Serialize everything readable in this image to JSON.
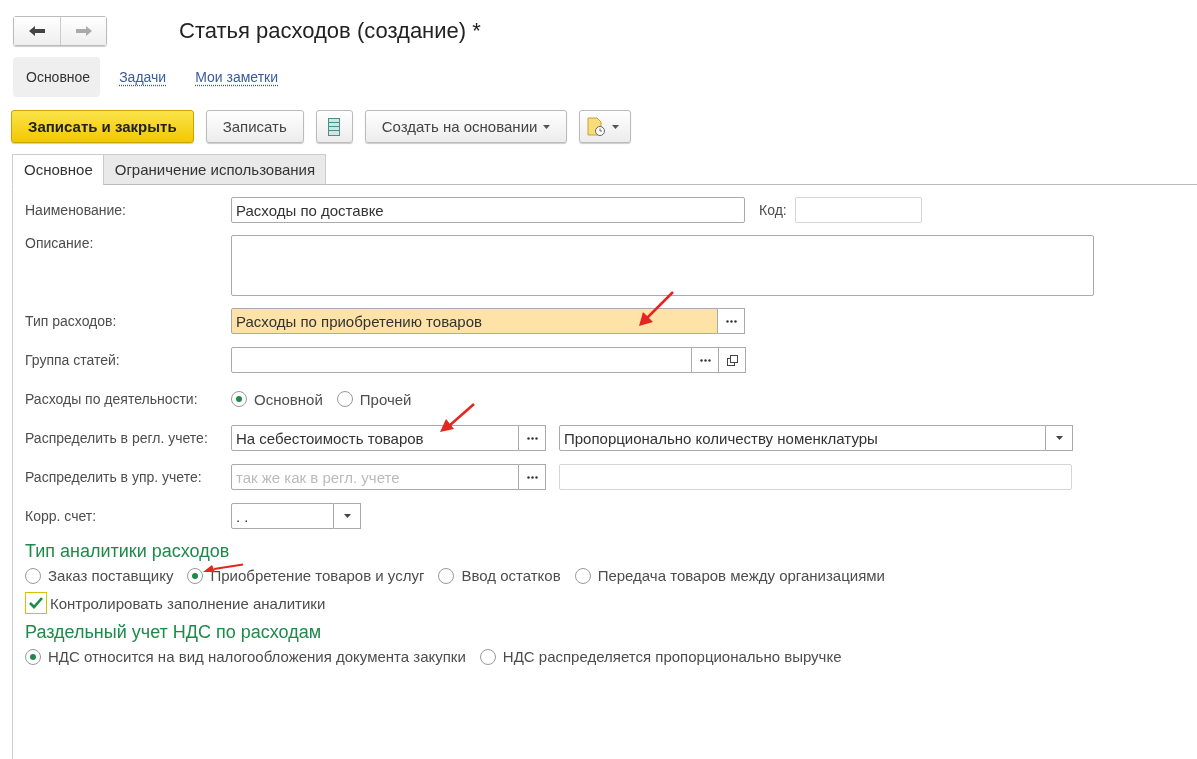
{
  "title": "Статья расходов (создание) *",
  "sections": [
    {
      "label": "Основное",
      "selected": true
    },
    {
      "label": "Задачи",
      "selected": false
    },
    {
      "label": "Мои заметки",
      "selected": false
    }
  ],
  "toolbar": {
    "primary": "Записать и закрыть",
    "save": "Записать",
    "create_based": "Создать на основании"
  },
  "tabs": [
    {
      "label": "Основное",
      "selected": true
    },
    {
      "label": "Ограничение использования",
      "selected": false
    }
  ],
  "name": {
    "label": "Наименование:",
    "value": "Расходы по доставке"
  },
  "code": {
    "label": "Код:"
  },
  "description": {
    "label": "Описание:"
  },
  "expense_type": {
    "label": "Тип расходов:",
    "value": "Расходы по приобретению товаров",
    "highlighted": true
  },
  "group": {
    "label": "Группа статей:"
  },
  "activity": {
    "label": "Расходы по деятельности:",
    "options": [
      {
        "label": "Основной",
        "selected": true
      },
      {
        "label": "Прочей",
        "selected": false
      }
    ]
  },
  "distribute_reg": {
    "label": "Распределить в регл. учете:",
    "value": "На себестоимость товаров",
    "method": "Пропорционально количеству номенклатуры"
  },
  "distribute_mgmt": {
    "label": "Распределить в упр. учете:",
    "placeholder": "так же как в регл. учете"
  },
  "corr_account": {
    "label": "Корр. счет:",
    "value": ". ."
  },
  "analytics": {
    "heading": "Тип аналитики расходов",
    "options": [
      {
        "label": "Заказ поставщику",
        "selected": false
      },
      {
        "label": "Приобретение товаров и услуг",
        "selected": true
      },
      {
        "label": "Ввод остатков",
        "selected": false
      },
      {
        "label": "Передача товаров между организациями",
        "selected": false
      }
    ]
  },
  "control_check": {
    "label": "Контролировать заполнение аналитики",
    "checked": true
  },
  "vat": {
    "heading": "Раздельный учет НДС по расходам",
    "options": [
      {
        "label": "НДС относится на вид налогообложения документа закупки",
        "selected": true
      },
      {
        "label": "НДС распределяется пропорционально выручке",
        "selected": false
      }
    ]
  }
}
